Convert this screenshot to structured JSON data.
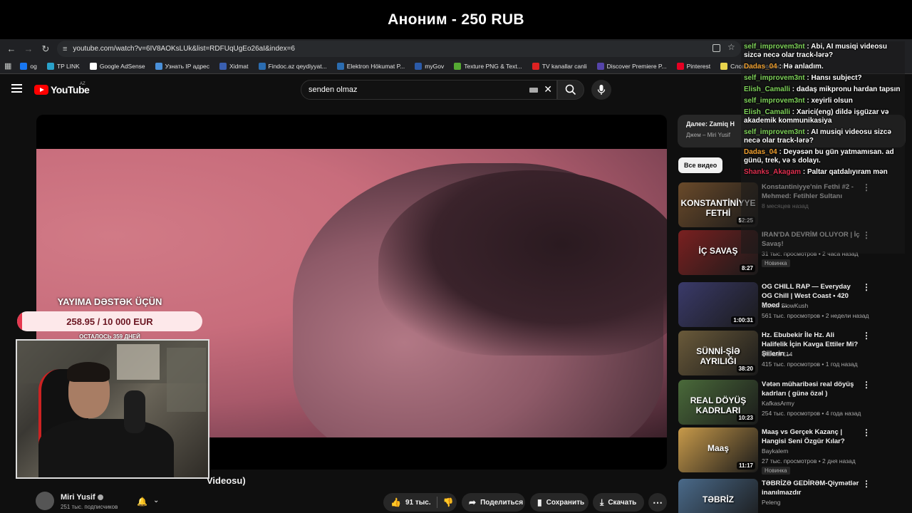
{
  "donation_banner": "Аноним - 250 RUB",
  "browser": {
    "url": "youtube.com/watch?v=6IV8AOKsLUk&list=RDFUqUgEo26aI&index=6",
    "bookmarks": [
      {
        "label": "og",
        "color": "#1877f2"
      },
      {
        "label": "TP LINK",
        "color": "#2aa1c9"
      },
      {
        "label": "Google AdSense",
        "color": "#ffffff"
      },
      {
        "label": "Узнать IP адрес",
        "color": "#4a90d9"
      },
      {
        "label": "Xidmat",
        "color": "#3a5fb0"
      },
      {
        "label": "Findoc.az qeydiyyat...",
        "color": "#2b6cb0"
      },
      {
        "label": "Elektron Hökumat P...",
        "color": "#2b6cb0"
      },
      {
        "label": "myGov",
        "color": "#2b5aa8"
      },
      {
        "label": "Texture PNG & Text...",
        "color": "#55aa33"
      },
      {
        "label": "TV kanallar canli",
        "color": "#dd2222"
      },
      {
        "label": "Discover Premiere P...",
        "color": "#5544aa"
      },
      {
        "label": "Pinterest",
        "color": "#e60023"
      },
      {
        "label": "Словарь игровых т",
        "color": "#e8d44d"
      }
    ]
  },
  "youtube": {
    "logo_text": "YouTube",
    "country": "AZ",
    "search_query": "senden olmaz"
  },
  "video": {
    "title_tail": "Videosu)",
    "channel": "Miri Yusif",
    "subscribers": "251 тыс. подписчиков",
    "likes": "91 тыс.",
    "share_label": "Поделиться",
    "save_label": "Сохранить",
    "download_label": "Скачать"
  },
  "stream_overlay": {
    "support_label": "YAYIMA DƏSTƏK ÜÇÜN",
    "progress_text": "258.95 / 10 000 EUR",
    "progress_fraction": 0.026,
    "days_left": "ОСТАЛОСЬ 359 ДНЕЙ"
  },
  "chat": [
    {
      "user": "self_improvem3nt",
      "color": "#7fd35a",
      "text": "Abi, AI musiqi videosu sizcə necə olar track-lərə?"
    },
    {
      "user": "Dadas_04",
      "color": "#f0a030",
      "text": "Hə anladım."
    },
    {
      "user": "self_improvem3nt",
      "color": "#7fd35a",
      "text": "Hansı subject?"
    },
    {
      "user": "Elish_Camalli",
      "color": "#7fd35a",
      "text": "dadaş mikpronu hardan tapsın"
    },
    {
      "user": "self_improvem3nt",
      "color": "#7fd35a",
      "text": "xeyirli olsun"
    },
    {
      "user": "Elish_Camalli",
      "color": "#7fd35a",
      "text": "Xarici(eng) dildə işgüzar və akademik kommunikasiya"
    },
    {
      "user": "self_improvem3nt",
      "color": "#7fd35a",
      "text": "AI musiqi videosu sizcə necə olar track-lərə?"
    },
    {
      "user": "Dadas_04",
      "color": "#f0a030",
      "text": "Deyəsən bu gün yatmamısan. ad günü, trek, və s dolayı."
    },
    {
      "user": "Shanks_Akagam",
      "color": "#e03050",
      "text": "Paltar qatdalıyıram mən"
    }
  ],
  "sidebar": {
    "up_next_label": "Далее: Zamiq H",
    "up_next_channel": "Джем – Miri Yusif",
    "chip_all": "Все видео",
    "recommendations": [
      {
        "thumb_text": "KONSTANTİNİYYE FETHİ",
        "thumb_color": "#6a4a2a",
        "duration": "52:25",
        "title": "Konstantiniyye'nin Fethi #2 - Mehmed: Fetihler Sultanı",
        "channel": "",
        "meta": "8 месяцев назад",
        "badge": ""
      },
      {
        "thumb_text": "İÇ SAVAŞ",
        "thumb_color": "#7a2020",
        "duration": "8:27",
        "title": "IRAN'DA DEVRİM OLUYOR | İç Savaş!",
        "channel": "",
        "meta": "31 тыс. просмотров • 2 часа назад",
        "badge": "Новинка"
      },
      {
        "thumb_text": "",
        "thumb_color": "#3a3a6a",
        "duration": "1:00:31",
        "title": "OG CHILL RAP — Everyday OG Chill | West Coast • 420 Mood ...",
        "channel": "Stoner SlowKush",
        "meta": "561 тыс. просмотров • 2 недели назад",
        "badge": ""
      },
      {
        "thumb_text": "SÜNNİ-ŞİƏ AYRILIĞI",
        "thumb_color": "#6a5a3a",
        "duration": "38:20",
        "title": "Hz. Ebubekir İle Hz. Ali Halifelik İçin Kavga Ettiler Mi? Şiilerin ...",
        "channel": "Maksat 114",
        "meta": "415 тыс. просмотров • 1 год назад",
        "badge": ""
      },
      {
        "thumb_text": "REAL DÖYÜŞ KADRLARI",
        "thumb_color": "#4a6a3a",
        "duration": "10:23",
        "title": "Vətən müharibəsi real döyüş kadrları ( günə özəl )",
        "channel": "KafkasArmy",
        "meta": "254 тыс. просмотров • 4 года назад",
        "badge": ""
      },
      {
        "thumb_text": "Maaş",
        "thumb_color": "#c89a4a",
        "duration": "11:17",
        "title": "Maaş vs Gerçek Kazanç | Hangisi Seni Özgür Kılar?",
        "channel": "Baykalem",
        "meta": "27 тыс. просмотров • 2 дня назад",
        "badge": "Новинка"
      },
      {
        "thumb_text": "TƏBRİZ",
        "thumb_color": "#4a6a8a",
        "duration": "",
        "title": "TƏBRİZƏ GEDİRƏM-Qiymətlər inanılmazdır",
        "channel": "Peleng",
        "meta": "",
        "badge": ""
      }
    ]
  },
  "colors": {
    "youtube_red": "#ff0000",
    "background": "#0f0f0f",
    "progress_fill": "#e53950",
    "progress_bg": "#fde8ea"
  }
}
